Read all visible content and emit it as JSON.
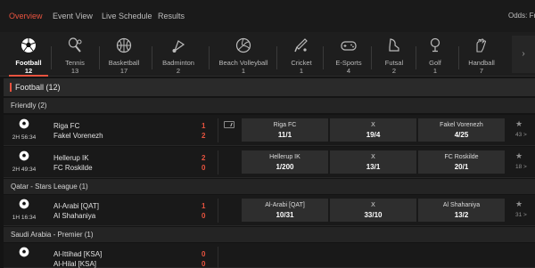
{
  "nav": {
    "tabs": [
      "Overview",
      "Event View",
      "Live Schedule",
      "Results"
    ],
    "odds_label": "Odds: Fr"
  },
  "colors": {
    "accent": "#e8533f",
    "background": "#141414",
    "odds_button": "#2e2e2e"
  },
  "sports": [
    {
      "name": "Football",
      "count": "12",
      "icon": "football-icon"
    },
    {
      "name": "Tennis",
      "count": "13",
      "icon": "tennis-icon"
    },
    {
      "name": "Basketball",
      "count": "17",
      "icon": "basketball-icon"
    },
    {
      "name": "Badminton",
      "count": "2",
      "icon": "shuttlecock-icon"
    },
    {
      "name": "Beach Volleyball",
      "count": "1",
      "icon": "volleyball-icon"
    },
    {
      "name": "Cricket",
      "count": "1",
      "icon": "cricket-icon"
    },
    {
      "name": "E-Sports",
      "count": "4",
      "icon": "gamepad-icon"
    },
    {
      "name": "Futsal",
      "count": "2",
      "icon": "futsal-icon"
    },
    {
      "name": "Golf",
      "count": "1",
      "icon": "golf-icon"
    },
    {
      "name": "Handball",
      "count": "7",
      "icon": "handball-icon"
    }
  ],
  "section": {
    "title": "Football (12)"
  },
  "leagues": [
    {
      "name": "Friendly (2)",
      "matches": [
        {
          "time": "2H 56:34",
          "home": "Riga FC",
          "away": "Fakel Vorenezh",
          "home_score": "1",
          "away_score": "2",
          "odds": [
            {
              "label": "Riga FC",
              "value": "11/1"
            },
            {
              "label": "X",
              "value": "19/4"
            },
            {
              "label": "Fakel Vorenezh",
              "value": "4/25"
            }
          ],
          "more": "43 >",
          "live_stream": true
        },
        {
          "time": "2H 49:34",
          "home": "Hellerup IK",
          "away": "FC Roskilde",
          "home_score": "2",
          "away_score": "0",
          "odds": [
            {
              "label": "Hellerup IK",
              "value": "1/200"
            },
            {
              "label": "X",
              "value": "13/1"
            },
            {
              "label": "FC Roskilde",
              "value": "20/1"
            }
          ],
          "more": "18 >",
          "live_stream": false
        }
      ]
    },
    {
      "name": "Qatar - Stars League (1)",
      "matches": [
        {
          "time": "1H 16:34",
          "home": "Al-Arabi [QAT]",
          "away": "Al Shahaniya",
          "home_score": "1",
          "away_score": "0",
          "odds": [
            {
              "label": "Al-Arabi [QAT]",
              "value": "10/31"
            },
            {
              "label": "X",
              "value": "33/10"
            },
            {
              "label": "Al Shahaniya",
              "value": "13/2"
            }
          ],
          "more": "31 >",
          "live_stream": false
        }
      ]
    },
    {
      "name": "Saudi Arabia - Premier (1)",
      "matches": [
        {
          "time": "",
          "home": "Al-Ittihad [KSA]",
          "away": "Al-Hilal [KSA]",
          "home_score": "0",
          "away_score": "0",
          "odds": [],
          "more": "",
          "live_stream": false
        }
      ]
    }
  ]
}
